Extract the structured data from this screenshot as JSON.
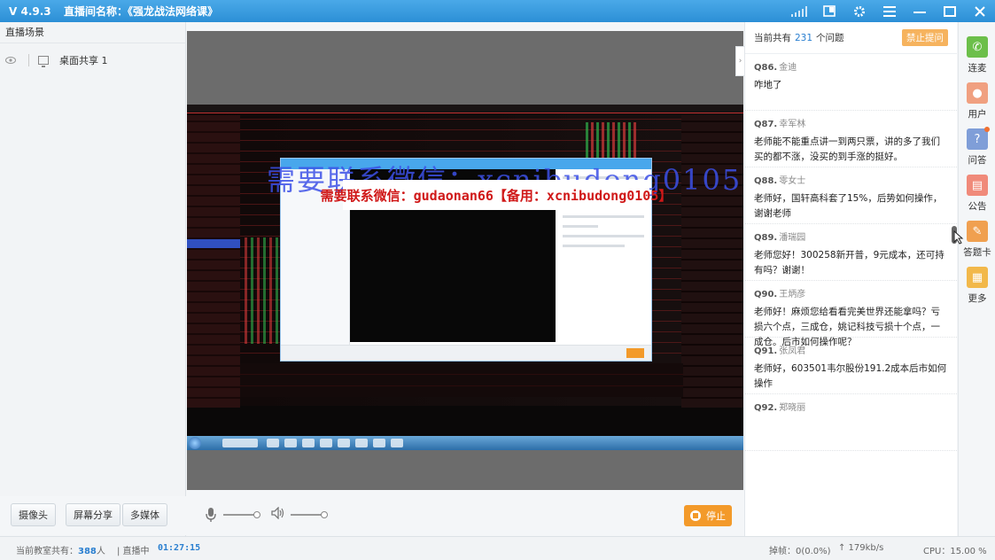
{
  "titlebar": {
    "version": "V 4.9.3",
    "room_name": "直播间名称：《强龙战法网络课》",
    "icons": [
      "signal-icon",
      "snapshot-icon",
      "gear-icon",
      "menu-icon",
      "minimize-icon",
      "maximize-icon",
      "close-icon"
    ]
  },
  "left_panel": {
    "header": "直播场景",
    "scenes": [
      {
        "label": "桌面共享 1",
        "icon": "monitor-icon"
      }
    ]
  },
  "video": {
    "watermark_text": "需要联系微信：xcnibudong0105",
    "overlay_text": "需要联系微信：gudaonan66【备用：xcnibudong0105】"
  },
  "controls": {
    "camera": "摄像头",
    "screen_share": "屏幕分享",
    "media": "多媒体",
    "mic_level": 1.0,
    "speaker_level": 1.0,
    "stop": "停止"
  },
  "status_bar": {
    "classroom_prefix": "当前教室共有：",
    "classroom_count": "388",
    "classroom_suffix": "人",
    "live_label": "| 直播中",
    "live_time": "01:27:15",
    "packet_loss": "掉帧：0(0.0%)",
    "bandwidth": "↑ 179kb/s",
    "cpu": "CPU：15.00 %"
  },
  "qa": {
    "count_prefix": "当前共有",
    "count": "231",
    "count_suffix": "个问题",
    "ban_button": "禁止提问",
    "questions": [
      {
        "num": "Q86.",
        "user": "金迪",
        "text": "咋地了"
      },
      {
        "num": "Q87.",
        "user": "幸军林",
        "text": "老师能不能重点讲一到两只票，讲的多了我们买的都不涨，没买的到手涨的挺好。"
      },
      {
        "num": "Q88.",
        "user": "零女士",
        "text": "老师好，国轩高科套了15%，后势如何操作，谢谢老师"
      },
      {
        "num": "Q89.",
        "user": "潘瑞园",
        "text": "老师您好！300258新开普，9元成本，还可持有吗？谢谢！"
      },
      {
        "num": "Q90.",
        "user": "王炳彦",
        "text": "老师好！麻烦您给看看完美世界还能拿吗？亏损六个点，三成仓，姚记科技亏损十个点，一成仓。后市如何操作呢？"
      },
      {
        "num": "Q91.",
        "user": "张凤君",
        "text": "老师好，603501韦尔股份191.2成本后市如何操作"
      },
      {
        "num": "Q92.",
        "user": "郑晓丽",
        "text": ""
      }
    ]
  },
  "iconbar": {
    "items": [
      {
        "label": "连麦",
        "icon": "phone-icon",
        "color": "#6cbf4a"
      },
      {
        "label": "用户",
        "icon": "user-icon",
        "color": "#f0a080"
      },
      {
        "label": "问答",
        "icon": "question-icon",
        "color": "#7f9ed8"
      },
      {
        "label": "公告",
        "icon": "notice-icon",
        "color": "#f08a7a"
      },
      {
        "label": "答题卡",
        "icon": "answer-card-icon",
        "color": "#f0a050"
      },
      {
        "label": "更多",
        "icon": "more-icon",
        "color": "#f2b84a"
      }
    ]
  }
}
